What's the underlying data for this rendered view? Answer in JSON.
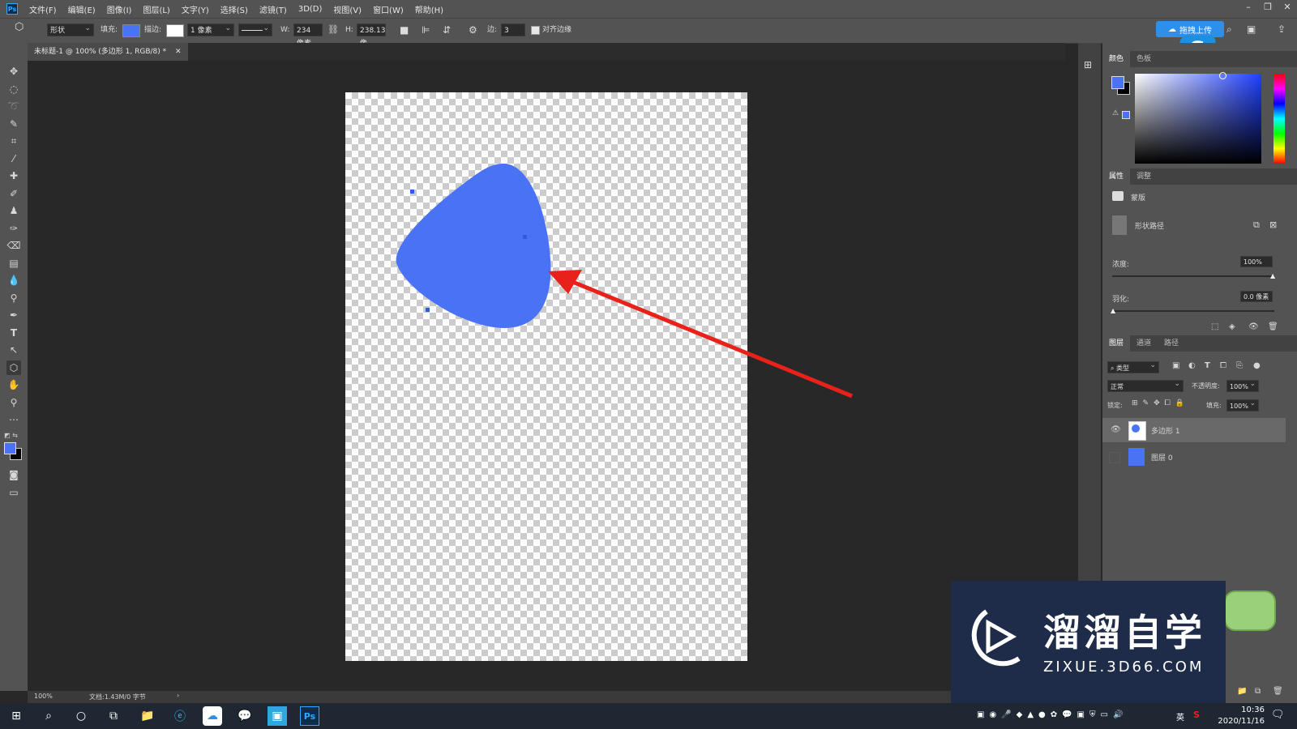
{
  "app": {
    "logo": "Ps"
  },
  "menu": [
    "文件(F)",
    "编辑(E)",
    "图像(I)",
    "图层(L)",
    "文字(Y)",
    "选择(S)",
    "滤镜(T)",
    "3D(D)",
    "视图(V)",
    "窗口(W)",
    "帮助(H)"
  ],
  "options": {
    "mode": "形状",
    "fill_label": "填充:",
    "fill_color": "#4a72f5",
    "stroke_label": "描边:",
    "stroke_width": "1 像素",
    "w_label": "W:",
    "w_value": "234 像素",
    "h_label": "H:",
    "h_value": "238.13 像",
    "sides_label": "边:",
    "sides_value": "3",
    "align_edges": "对齐边缘",
    "cloud_upload": "拖拽上传"
  },
  "document": {
    "tab_title": "未标题-1 @ 100% (多边形 1, RGB/8) *",
    "zoom": "100%",
    "doc_info": "文档:1.43M/0 字节"
  },
  "panels": {
    "color_tabs": [
      "颜色",
      "色板"
    ],
    "properties_tabs": [
      "属性",
      "调整"
    ],
    "mask_label": "蒙版",
    "shape_path_label": "形状路径",
    "density_label": "浓度:",
    "density_value": "100%",
    "feather_label": "羽化:",
    "feather_value": "0.0 像素",
    "layers_tabs": [
      "图层",
      "通道",
      "路径"
    ],
    "filter_kind": "类型",
    "blend_mode": "正常",
    "opacity_label": "不透明度:",
    "opacity_value": "100%",
    "lock_label": "锁定:",
    "fill_label": "填充:",
    "fill_value": "100%",
    "layers": [
      {
        "name": "多边形 1",
        "visible": true,
        "selected": true
      },
      {
        "name": "图层 0",
        "visible": false,
        "selected": false
      }
    ]
  },
  "colors": {
    "foreground": "#4a72f5",
    "shape": "#4a72f5",
    "arrow": "#e8221b"
  },
  "watermark": {
    "title": "溜溜自学",
    "subtitle": "ZIXUE.3D66.COM"
  },
  "taskbar": {
    "time": "10:36",
    "date": "2020/11/16",
    "ime": "英"
  }
}
